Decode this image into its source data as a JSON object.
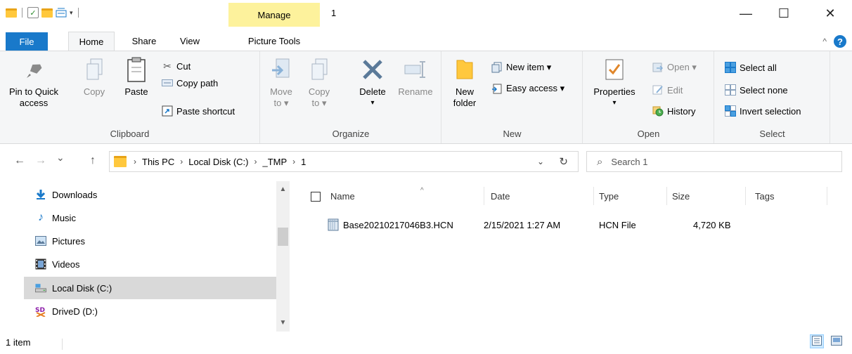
{
  "window": {
    "title": "1",
    "contextual_tab": "Manage",
    "minimize_glyph": "—",
    "maximize_glyph": "☐",
    "close_glyph": "✕"
  },
  "tabs": {
    "file": "File",
    "home": "Home",
    "share": "Share",
    "view": "View",
    "picture_tools": "Picture Tools",
    "collapse_glyph": "^",
    "help_glyph": "?"
  },
  "ribbon": {
    "clipboard": {
      "label": "Clipboard",
      "pin_line1": "Pin to Quick",
      "pin_line2": "access",
      "copy": "Copy",
      "paste": "Paste",
      "cut": "Cut",
      "copy_path": "Copy path",
      "paste_shortcut": "Paste shortcut"
    },
    "organize": {
      "label": "Organize",
      "move_line1": "Move",
      "move_line2": "to ▾",
      "copy_line1": "Copy",
      "copy_line2": "to ▾",
      "delete_line1": "Delete",
      "delete_line2": "▾",
      "rename": "Rename"
    },
    "new": {
      "label": "New",
      "new_folder_line1": "New",
      "new_folder_line2": "folder",
      "new_item": "New item ▾",
      "easy_access": "Easy access ▾"
    },
    "open": {
      "label": "Open",
      "properties_line1": "Properties",
      "properties_line2": "▾",
      "open": "Open ▾",
      "edit": "Edit",
      "history": "History"
    },
    "select": {
      "label": "Select",
      "select_all": "Select all",
      "select_none": "Select none",
      "invert_selection": "Invert selection"
    }
  },
  "address": {
    "back_glyph": "←",
    "forward_glyph": "→",
    "recent_glyph": "⌄",
    "up_glyph": "↑",
    "crumbs": [
      "This PC",
      "Local Disk (C:)",
      "_TMP",
      "1"
    ],
    "crumb_sep": "›",
    "dropdown_glyph": "⌄",
    "refresh_glyph": "↻",
    "search_placeholder": "Search 1",
    "search_glyph": "⌕"
  },
  "nav_pane": {
    "items": [
      {
        "label": "Downloads",
        "icon": "download-icon"
      },
      {
        "label": "Music",
        "icon": "music-icon"
      },
      {
        "label": "Pictures",
        "icon": "pictures-icon"
      },
      {
        "label": "Videos",
        "icon": "videos-icon"
      },
      {
        "label": "Local Disk (C:)",
        "icon": "drive-icon",
        "selected": true
      },
      {
        "label": "DriveD (D:)",
        "icon": "drive-d-icon"
      }
    ],
    "scroll_up": "▲",
    "scroll_down": "▼"
  },
  "file_list": {
    "columns": [
      "Name",
      "Date",
      "Type",
      "Size",
      "Tags"
    ],
    "sort_glyph": "^",
    "rows": [
      {
        "name": "Base20210217046B3.HCN",
        "date": "2/15/2021 1:27 AM",
        "type": "HCN File",
        "size": "4,720 KB",
        "tags": ""
      }
    ]
  },
  "status": {
    "item_count": "1 item"
  }
}
